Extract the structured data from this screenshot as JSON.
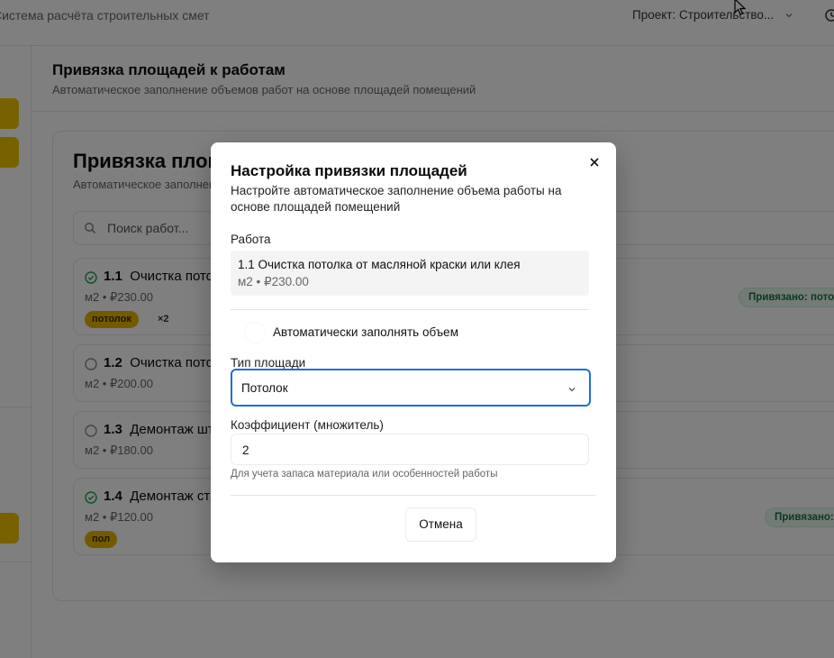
{
  "app": {
    "title": "Система расчёта строительных смет",
    "project_label": "Проект: Строительство..."
  },
  "page": {
    "title": "Привязка площадей к работам",
    "subtitle": "Автоматическое заполнение объемов работ на основе площадей помещений"
  },
  "card": {
    "title": "Привязка площадей к работам",
    "subtitle": "Автоматическое заполнение объемов работ на основе площадей помещений",
    "search_placeholder": "Поиск работ..."
  },
  "works": [
    {
      "num": "1.1",
      "name": "Очистка потолка от масляной краски или клея",
      "meta": "м2 • ₽230.00",
      "bound": true,
      "tag": "потолок",
      "extra": "×2",
      "badge": "Привязано: потолок"
    },
    {
      "num": "1.2",
      "name": "Очистка потолка",
      "meta": "м2 • ₽200.00",
      "bound": false
    },
    {
      "num": "1.3",
      "name": "Демонтаж штукатурки",
      "meta": "м2 • ₽180.00",
      "bound": false
    },
    {
      "num": "1.4",
      "name": "Демонтаж стяжки",
      "meta": "м2 • ₽120.00",
      "bound": true,
      "tag": "пол",
      "badge": "Привязано: пол"
    }
  ],
  "dialog": {
    "title": "Настройка привязки площадей",
    "description": "Настройте автоматическое заполнение объема работы на основе площадей помещений",
    "work_label": "Работа",
    "work_name": "1.1 Очистка потолка от масляной краски или клея",
    "work_price": "м2 • ₽230.00",
    "auto_fill_label": "Автоматически заполнять объем",
    "area_type_label": "Тип площади",
    "area_type_value": "Потолок",
    "coefficient_label": "Коэффициент (множитель)",
    "coefficient_value": "2",
    "coefficient_hint": "Для учета запаса материала или особенностей работы",
    "cancel_label": "Отмена"
  },
  "colors": {
    "accent_yellow": "#f0c400",
    "focus_blue": "#1f6fd6",
    "bound_green": "#16753a"
  }
}
